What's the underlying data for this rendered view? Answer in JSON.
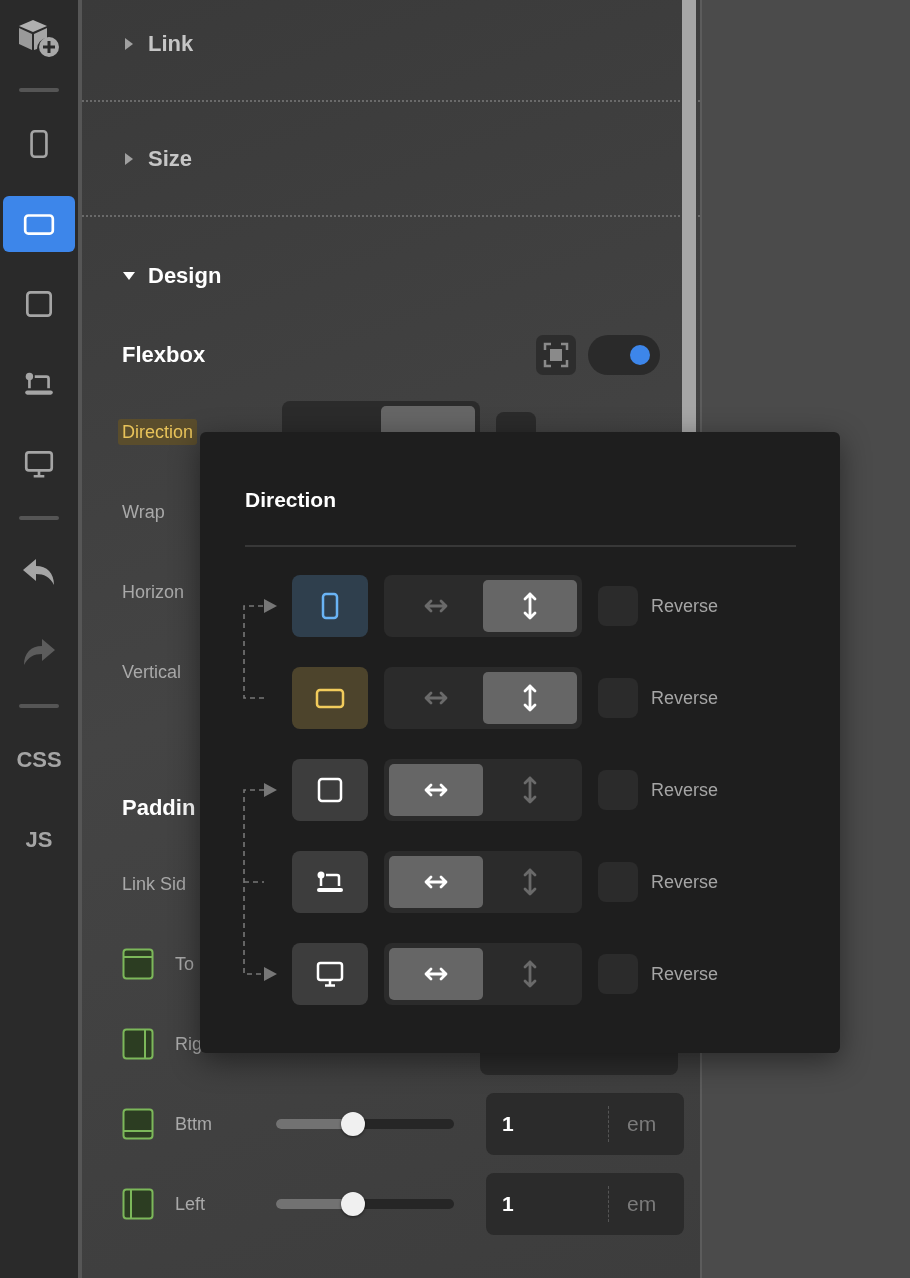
{
  "sidebar": {
    "items": [
      {
        "kind": "add-component",
        "selected": false
      },
      {
        "kind": "divider"
      },
      {
        "kind": "phone",
        "selected": false
      },
      {
        "kind": "tablet",
        "selected": true
      },
      {
        "kind": "square",
        "selected": false
      },
      {
        "kind": "laptop",
        "selected": false
      },
      {
        "kind": "desktop",
        "selected": false
      },
      {
        "kind": "divider"
      },
      {
        "kind": "undo",
        "selected": false,
        "disabled": false
      },
      {
        "kind": "redo",
        "selected": false,
        "disabled": true
      },
      {
        "kind": "divider"
      },
      {
        "kind": "text",
        "label": "CSS",
        "selected": false
      },
      {
        "kind": "text",
        "label": "JS",
        "selected": false
      }
    ]
  },
  "panel": {
    "sections": [
      {
        "title": "Link",
        "expanded": false
      },
      {
        "title": "Size",
        "expanded": false
      },
      {
        "title": "Design",
        "expanded": true
      }
    ],
    "flexbox": {
      "title": "Flexbox",
      "enabled": true,
      "direction": {
        "label": "Direction",
        "highlighted": true,
        "segments": [
          {
            "selected": false
          },
          {
            "selected": true
          }
        ],
        "reverse": {
          "checked": false
        }
      },
      "other_rows": [
        {
          "label": "Wrap",
          "highlighted": false
        },
        {
          "label": "Horizon",
          "highlighted": false
        },
        {
          "label": "Vertical",
          "highlighted": false
        }
      ]
    },
    "padding": {
      "title": "Paddin",
      "link_sides_label": "Link Sid",
      "sides": [
        {
          "kind": "top",
          "label": "To"
        },
        {
          "kind": "right",
          "label": "Rig",
          "field": true
        },
        {
          "kind": "bottom",
          "label": "Bttm",
          "level": 0.43,
          "value": "1",
          "unit": "em"
        },
        {
          "kind": "left",
          "label": "Left",
          "level": 0.43,
          "value": "1",
          "unit": "em"
        }
      ]
    }
  },
  "popup": {
    "title": "Direction",
    "rows": [
      {
        "kind": "phone",
        "color": "#6ab4f5",
        "segments": [
          {
            "kind": "horizontal",
            "selected": false
          },
          {
            "kind": "vertical",
            "selected": true
          }
        ],
        "reverse": {
          "label": "Reverse",
          "checked": false
        }
      },
      {
        "kind": "tablet",
        "color": "#f2cc5c",
        "segments": [
          {
            "kind": "horizontal",
            "selected": false
          },
          {
            "kind": "vertical",
            "selected": true
          }
        ],
        "reverse": {
          "label": "Reverse",
          "checked": false
        }
      },
      {
        "kind": "square",
        "segments": [
          {
            "kind": "horizontal",
            "selected": true
          },
          {
            "kind": "vertical",
            "selected": false
          }
        ],
        "reverse": {
          "label": "Reverse",
          "checked": false
        }
      },
      {
        "kind": "laptop",
        "segments": [
          {
            "kind": "horizontal",
            "selected": true
          },
          {
            "kind": "vertical",
            "selected": false
          }
        ],
        "reverse": {
          "label": "Reverse",
          "checked": false
        }
      },
      {
        "kind": "desktop",
        "segments": [
          {
            "kind": "horizontal",
            "selected": true
          },
          {
            "kind": "vertical",
            "selected": false
          }
        ],
        "reverse": {
          "label": "Reverse",
          "checked": false
        }
      }
    ]
  }
}
